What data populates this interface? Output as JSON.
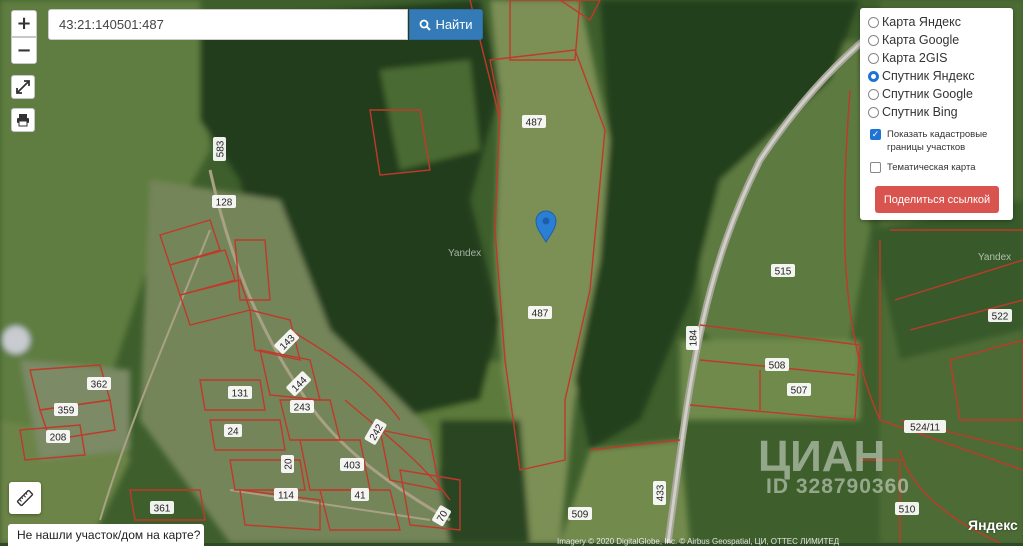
{
  "search": {
    "value": "43:21:140501:487",
    "button_label": "Найти"
  },
  "zoom": {
    "in_label": "+",
    "out_label": "−"
  },
  "layers": {
    "options": [
      {
        "label": "Карта Яндекс",
        "selected": false
      },
      {
        "label": "Карта Google",
        "selected": false
      },
      {
        "label": "Карта 2GIS",
        "selected": false
      },
      {
        "label": "Спутник Яндекс",
        "selected": true
      },
      {
        "label": "Спутник Google",
        "selected": false
      },
      {
        "label": "Спутник Bing",
        "selected": false
      }
    ],
    "show_boundaries": {
      "label": "Показать кадастровые границы участков",
      "checked": true
    },
    "thematic": {
      "label": "Тематическая карта",
      "checked": false
    },
    "share_label": "Поделиться ссылкой"
  },
  "parcel_labels": [
    "487",
    "487",
    "515",
    "522",
    "508",
    "507",
    "524/11",
    "510",
    "509",
    "433",
    "184",
    "583",
    "128",
    "143",
    "144",
    "131",
    "243",
    "24",
    "242",
    "403",
    "41",
    "114",
    "361",
    "362",
    "359",
    "208",
    "70",
    "20"
  ],
  "road_label": "184",
  "bottom_bar": {
    "not_found": "Не нашли участок/дом на карте?",
    "copyright": "Imagery © 2020 DigitalGlobe, Inc. © Airbus Geospatial, ЦИ, ОТТЕС ЛИМИТЕД",
    "yandex_logo": "Яндекс"
  },
  "watermarks": {
    "yandex": "Yandex",
    "cian": "ЦИАН",
    "cian_id": "ID 328790360"
  },
  "colors": {
    "boundary": "#c0392b",
    "marker": "#2a7fd4",
    "share": "#d9534f",
    "search": "#337ab7"
  }
}
